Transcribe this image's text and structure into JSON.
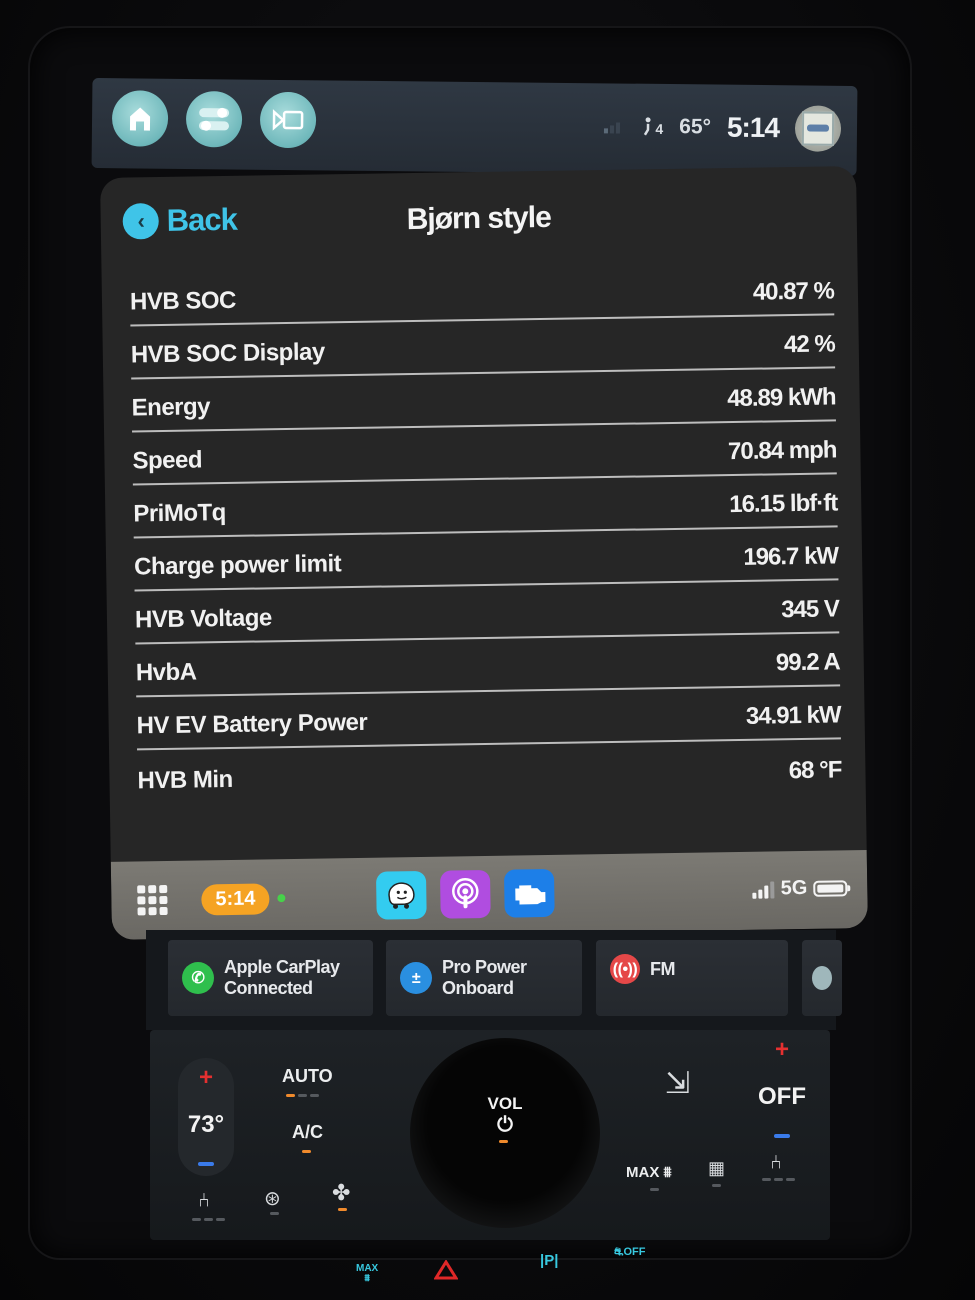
{
  "topbar": {
    "buttons": [
      {
        "name": "home",
        "icon": "home-icon"
      },
      {
        "name": "settings",
        "icon": "toggles-icon"
      },
      {
        "name": "camera",
        "icon": "camera-icon"
      }
    ],
    "signal_icon": "signal-icon",
    "passenger_icon": "passenger-icon",
    "passenger_count": "4",
    "outside_temp": "65°",
    "time": "5:14",
    "profile_icon": "profile-picture-icon"
  },
  "screen": {
    "back_label": "Back",
    "title": "Bjørn style",
    "rows": [
      {
        "label": "HVB SOC",
        "value": "40.87 %"
      },
      {
        "label": "HVB SOC Display",
        "value": "42 %"
      },
      {
        "label": "Energy",
        "value": "48.89 kWh"
      },
      {
        "label": "Speed",
        "value": "70.84 mph"
      },
      {
        "label": "PriMoTq",
        "value": "16.15 lbf·ft"
      },
      {
        "label": "Charge power limit",
        "value": "196.7 kW"
      },
      {
        "label": "HVB Voltage",
        "value": "345 V"
      },
      {
        "label": "HvbA",
        "value": "99.2 A"
      },
      {
        "label": "HV EV Battery Power",
        "value": "34.91 kW"
      },
      {
        "label": "HVB Min",
        "value": "68 °F"
      }
    ]
  },
  "dock": {
    "time_pill": "5:14",
    "apps": [
      {
        "name": "Waze",
        "color": "#33ccf0"
      },
      {
        "name": "Podcasts",
        "color": "#b04de0"
      },
      {
        "name": "OBD / Engine",
        "color": "#1d7fe8"
      }
    ],
    "network": "5G"
  },
  "tiles": [
    {
      "line1": "Apple CarPlay",
      "line2": "Connected",
      "icon": "phone-icon",
      "color": "#2fbf4d"
    },
    {
      "line1": "Pro Power",
      "line2": "Onboard",
      "icon": "power-outlet-icon",
      "color": "#2a8fe0"
    },
    {
      "line1": "FM",
      "line2": "",
      "icon": "radio-icon",
      "color": "#e54848"
    }
  ],
  "climate": {
    "driver_temp": "73°",
    "auto_label": "AUTO",
    "ac_label": "A/C",
    "vol_label": "VOL",
    "passenger_temp": "OFF",
    "max_defrost_label": "MAX"
  },
  "hardbuttons": {
    "max_defrost": "MAX",
    "park": "|P|",
    "traction_off": "OFF"
  }
}
